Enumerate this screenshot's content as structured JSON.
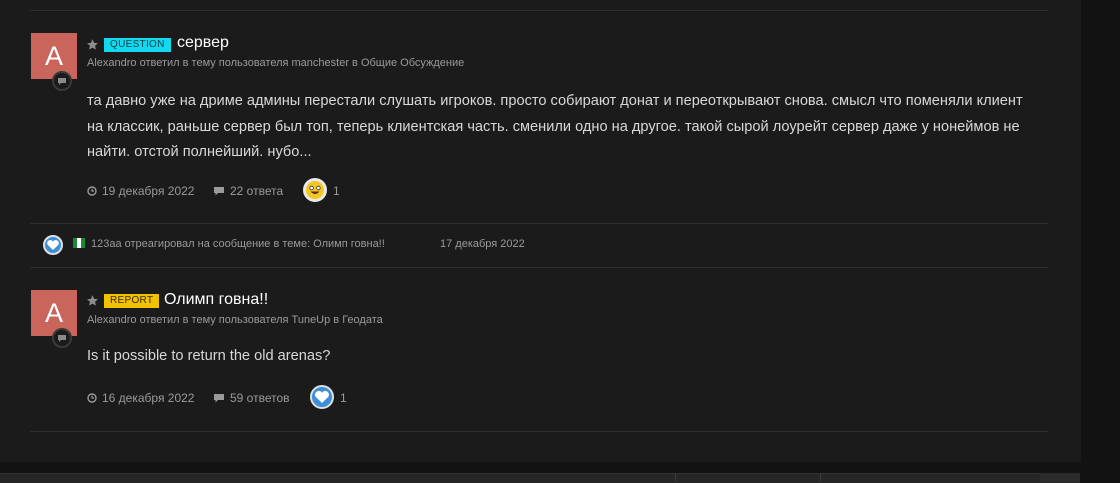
{
  "posts": [
    {
      "avatar_letter": "A",
      "tag": "QUESTION",
      "title": "сервер",
      "meta": "Alexandro ответил в тему пользователя manchester в Общие Обсуждение",
      "body": "та давно уже на дриме админы перестали слушать игроков. просто собирают донат и переоткрывают снова. смысл что поменяли клиент на классик, раньше сервер был топ, теперь клиентская часть. сменили одно на другое. такой сырой лоурейт сервер даже у нонеймов не найти. отстой полнейший. нубо...",
      "date": "19 декабря 2022",
      "replies": "22 ответа",
      "reaction_icon": "haha-emoji-icon",
      "reaction_count": "1"
    },
    {
      "avatar_letter": "A",
      "tag": "REPORT",
      "title": "Олимп говна!!",
      "meta": "Alexandro ответил в тему пользователя TuneUp в Геодата",
      "body": "Is it possible to return the old arenas?",
      "date": "16 декабря 2022",
      "replies": "59 ответов",
      "reaction_icon": "like-heart-icon",
      "reaction_count": "1"
    }
  ],
  "activity": {
    "text": "123aa отреагировал на сообщение в теме: Олимп говна!!",
    "date": "17 декабря 2022"
  },
  "colors": {
    "avatar": "#c9655a",
    "question_tag": "#12d9f0",
    "report_tag": "#f2c200",
    "like": "#3d8fd9"
  }
}
